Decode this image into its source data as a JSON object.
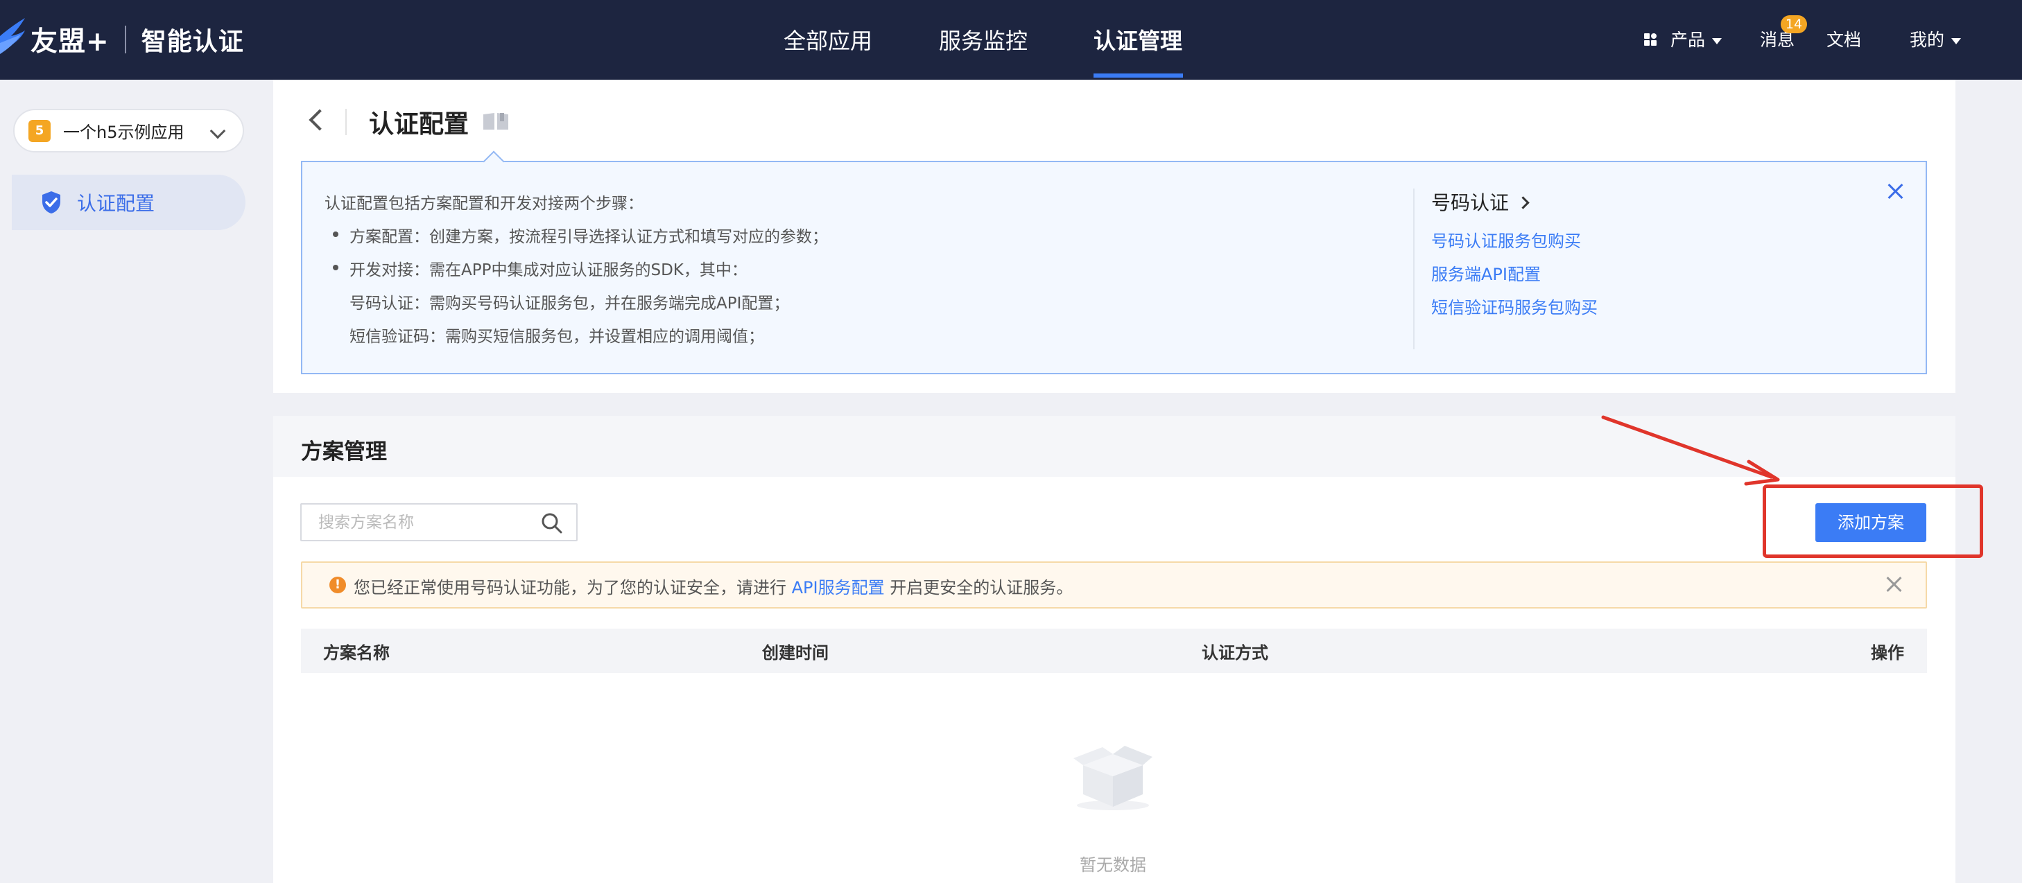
{
  "header": {
    "brand": "友盟+",
    "product": "智能认证",
    "nav": [
      "全部应用",
      "服务监控",
      "认证管理"
    ],
    "active_nav": "认证管理",
    "right": {
      "products": "产品",
      "messages": "消息",
      "message_count": "14",
      "docs": "文档",
      "mine": "我的"
    }
  },
  "sidebar": {
    "app_select": "一个h5示例应用",
    "items": [
      {
        "label": "认证配置",
        "icon": "shield-check-icon"
      }
    ]
  },
  "config": {
    "title": "认证配置",
    "intro": "认证配置包括方案配置和开发对接两个步骤：",
    "bullets": [
      "方案配置：创建方案，按流程引导选择认证方式和填写对应的参数；",
      "开发对接：需在APP中集成对应认证服务的SDK，其中："
    ],
    "sub_lines": [
      "号码认证：需购买号码认证服务包，并在服务端完成API配置；",
      "短信验证码：需购买短信服务包，并设置相应的调用阈值；"
    ],
    "right_title": "号码认证",
    "links": [
      "号码认证服务包购买",
      "服务端API配置",
      "短信验证码服务包购买"
    ]
  },
  "schemes": {
    "title": "方案管理",
    "search_placeholder": "搜索方案名称",
    "add_button": "添加方案",
    "warning": {
      "before": "您已经正常使用号码认证功能，为了您的认证安全，请进行 ",
      "link": "API服务配置",
      "after": " 开启更安全的认证服务。"
    },
    "columns": [
      "方案名称",
      "创建时间",
      "认证方式",
      "操作"
    ],
    "empty_text": "暂无数据"
  },
  "colors": {
    "primary": "#3b7cf5",
    "header_bg": "#1d2540",
    "badge": "#f4a623",
    "annotation": "#e0352b"
  }
}
